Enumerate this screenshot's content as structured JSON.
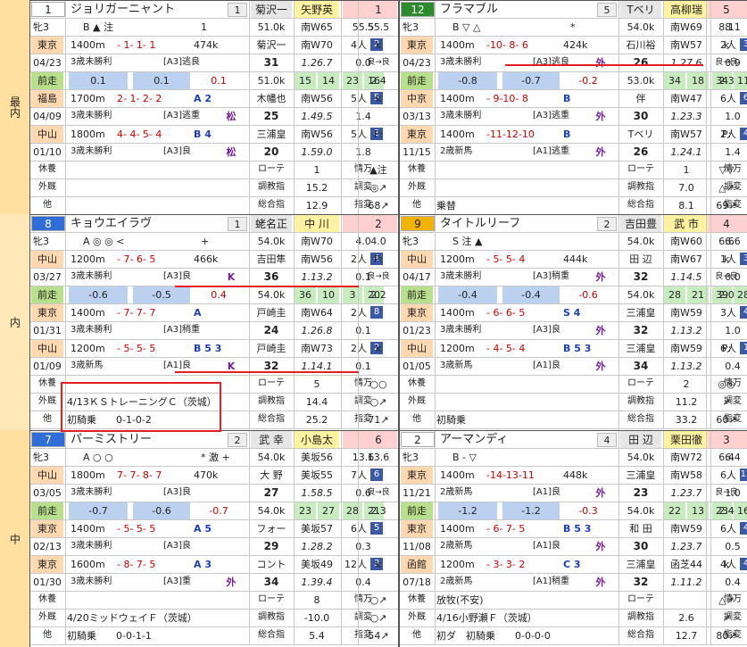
{
  "waku": [
    {
      "label": "最内"
    },
    {
      "label": "内"
    },
    {
      "label": "中"
    }
  ],
  "horses": [
    {
      "id": "h1",
      "num": "1",
      "name": "ジョリガーニャント",
      "gate": "1",
      "jockey_prev": "菊沢一",
      "jockey": "矢野英",
      "odds_a": "1",
      "odds_b": "1",
      "sexage": "牝3",
      "marks": "B ▲ 注",
      "marks2": "1",
      "weight": "51.0k",
      "trainer": "南W65",
      "wt1": "55.5",
      "wt2": "55.5",
      "r1": {
        "tr": "東京",
        "d": "04/23",
        "dist": "1400m",
        "pos": "- 1- 1- 1",
        "wt": "474k",
        "cls": "3歳未勝利",
        "grade": "[A3]逃良",
        "j": "菊沢一",
        "tw": "南W70",
        "pl": "4人",
        "plb": "2",
        "k": "k",
        "n": "31",
        "time": "1.26.7",
        "diff": "0.0",
        "ex": "0.0",
        "fg": "良→良"
      },
      "zen": {
        "a": "0.1",
        "b": "0.1",
        "c": "0.1",
        "t1": "51.0k",
        "t2": "15",
        "t3": "14",
        "t4": "23",
        "t5": "16",
        "t6": "2.4"
      },
      "r2": {
        "tr": "福島",
        "d": "04/09",
        "dist": "1700m",
        "pos": "2- 1- 2- 2",
        "ab": "A 2",
        "cls": "3歳未勝利",
        "grade": "[A3]逃重",
        "mk": "松",
        "j": "木幡也",
        "tw": "南W56",
        "pl": "5人",
        "plb": "5",
        "k": "k",
        "n": "25",
        "time": "1.49.5",
        "diff": "1.4",
        "ex": "0.0"
      },
      "r3": {
        "tr": "中山",
        "d": "01/10",
        "dist": "1800m",
        "pos": "4- 4- 5- 4",
        "ab": "B 4",
        "cls": "3歳未勝利",
        "grade": "[A3]良",
        "mk": "松",
        "j": "三浦皇",
        "tw": "南W56",
        "pl": "5人",
        "plb": "8",
        "k": "P:",
        "n": "20",
        "time": "1.59.0",
        "diff": "1.8",
        "ex": ""
      },
      "foot": {
        "kyu": "休養",
        "ga": "外厩",
        "ta": "他",
        "txt1": "",
        "txt2": "",
        "lot": "ローテ",
        "lotv": "1",
        "jo": "情万",
        "jov": "5",
        "sym": "▲注",
        "cho": "調教指",
        "chov": "15.2",
        "chos": "調変",
        "chosv": "1",
        "symb": "◎↗",
        "sogo": "総合指",
        "sogov": "12.9",
        "sogos": "指変",
        "sogosv": "8",
        "symc": "68↗"
      }
    },
    {
      "id": "h12",
      "num": "12",
      "name": "フラマブル",
      "gate": "5",
      "jockey_prev": "Tベリ",
      "jockey": "高柳瑞",
      "odds_a": "5",
      "odds_b": "5",
      "sexage": "牝3",
      "marks": "B ▽ △",
      "marks2": "*",
      "weight": "54.0k",
      "trainer": "南W69",
      "wt1": "8.1",
      "wt2": "8.1",
      "r1": {
        "tr": "東京",
        "d": "04/23",
        "dist": "1400m",
        "pos": "-10- 8- 6",
        "wt": "424k",
        "cls": "3歳未勝利",
        "grade": "[A3]逃良",
        "mk": "外",
        "j": "石川裕",
        "tw": "南W57",
        "pl": "2人",
        "plb": "3",
        "k": "k",
        "n": "26",
        "time": "1.27.6",
        "diff": "0.9",
        "ex": "1.1",
        "fg": "良→良"
      },
      "zen": {
        "a": "-0.8",
        "b": "-0.7",
        "c": "-0.2",
        "t1": "53.0k",
        "t2": "34",
        "t3": "18",
        "t4": "34",
        "t5": "11",
        "t6": "2.3"
      },
      "r2": {
        "tr": "中京",
        "d": "03/13",
        "dist": "1400m",
        "pos": "- 9-10- 8",
        "ab": "B",
        "cls": "3歳未勝利",
        "grade": "[A3]逃重",
        "mk": "外",
        "j": "伴",
        "tw": "南W47",
        "pl": "6人",
        "plb": "6",
        "k": "",
        "n": "30",
        "time": "1.23.3",
        "diff": "1.0",
        "ex": ""
      },
      "r3": {
        "tr": "東京",
        "d": "11/15",
        "dist": "1400m",
        "pos": "-11-12-10",
        "ab": "B",
        "cls": "2歳新馬",
        "grade": "[A1]逃重",
        "mk": "外",
        "j": "Tベリ",
        "tw": "南W57",
        "pl": "2人",
        "plb": "4",
        "k": "P:",
        "n": "26",
        "time": "1.24.1",
        "diff": "1.4",
        "ex": ""
      },
      "foot": {
        "kyu": "休養",
        "ga": "外厩",
        "ta": "他",
        "txt1": "",
        "txt2": "",
        "txt3": "乗替",
        "lot": "ローテ",
        "lotv": "1",
        "jo": "情万",
        "jov": "10",
        "sym": "▽▽",
        "cho": "調教指",
        "chov": "7.0",
        "chos": "調変",
        "chosv": "2",
        "symb": "△↗",
        "sogo": "総合指",
        "sogov": "8.1",
        "sogos": "指変",
        "sogosv": "4",
        "symc": "69↗"
      }
    },
    {
      "id": "h8",
      "num": "8",
      "name": "キョウエイラヴ",
      "gate": "1",
      "jockey_prev": "蛯名正",
      "jockey": "中 川",
      "odds_a": "2",
      "odds_b": "2",
      "sexage": "牝3",
      "marks": "A ◎ ◎ <",
      "marks2": "+",
      "weight": "54.0k",
      "trainer": "南W70",
      "wt1": "4.0",
      "wt2": "4.0",
      "r1": {
        "tr": "中山",
        "d": "03/27",
        "dist": "1200m",
        "pos": "- 7- 6- 5",
        "wt": "466k",
        "cls": "3歳未勝利",
        "grade": "[A3]良",
        "mk": "K",
        "j": "吉田隼",
        "tw": "南W56",
        "pl": "2人",
        "plb": "4",
        "k": "P:",
        "n": "36",
        "time": "1.13.2",
        "diff": "0.1",
        "ex": "0.0",
        "fg": "良→良"
      },
      "zen": {
        "a": "-0.6",
        "b": "-0.5",
        "c": "0.4",
        "t1": "54.0k",
        "t2": "36",
        "t3": "10",
        "t4": "3",
        "t5": "20",
        "t6": "2.2"
      },
      "r2": {
        "tr": "東京",
        "d": "01/31",
        "dist": "1400m",
        "pos": "- 7- 7- 7",
        "ab": "A",
        "cls": "3歳未勝利",
        "grade": "[A3]稍重",
        "mk": "",
        "j": "戸崎圭",
        "tw": "南W64",
        "pl": "2人",
        "plb": "8",
        "k": "",
        "n": "24",
        "time": "1.26.8",
        "diff": "0.1",
        "ex": ""
      },
      "r3": {
        "tr": "中山",
        "d": "01/09",
        "dist": "1200m",
        "pos": "- 5- 5- 5",
        "ab": "B 5 3",
        "cls": "3歳新馬",
        "grade": "[A1]良",
        "mk": "K",
        "j": "戸崎圭",
        "tw": "南W73",
        "pl": "2人",
        "plb": "2",
        "k": "k",
        "n": "32",
        "time": "1.14.1",
        "diff": "0.1",
        "ex": ""
      },
      "foot": {
        "kyu": "休養",
        "ga": "外厩",
        "ta": "他",
        "txt1": "4/13ＫＳトレーニングＣ（茨城）",
        "txt2": "初騎乗　　0-1-0-2",
        "lot": "ローテ",
        "lotv": "5",
        "jo": "情万",
        "jov": "5",
        "sym": "○○",
        "cho": "調教指",
        "chov": "14.4",
        "chos": "調変",
        "chosv": "1",
        "symb": "○↗",
        "sogo": "総合指",
        "sogov": "25.2",
        "sogos": "指変",
        "sogosv": "2",
        "symc": "71↗"
      }
    },
    {
      "id": "h9",
      "num": "9",
      "name": "タイトルリーフ",
      "gate": "2",
      "jockey_prev": "吉田豊",
      "jockey": "武 市",
      "odds_a": "4",
      "odds_b": "4",
      "sexage": "牝3",
      "marks": "S 注 ▲",
      "marks2": "",
      "weight": "54.0k",
      "trainer": "南W60",
      "wt1": "6.6",
      "wt2": "6.6",
      "r1": {
        "tr": "中山",
        "d": "04/17",
        "dist": "1200m",
        "pos": "- 5- 5- 4",
        "wt": "444k",
        "cls": "3歳未勝利",
        "grade": "[A3]稍重",
        "mk": "外",
        "j": "田 辺",
        "tw": "南W67",
        "pl": "1人",
        "plb": "3",
        "k": "k",
        "n": "32",
        "time": "1.14.5",
        "diff": "0.0",
        "ex": "0.0",
        "fg": "良→良"
      },
      "zen": {
        "a": "-0.4",
        "b": "-0.4",
        "c": "-0.6",
        "t1": "54.0k",
        "t2": "28",
        "t3": "21",
        "t4": "39",
        "t5": "28",
        "t6": "2.0"
      },
      "r2": {
        "tr": "東京",
        "d": "01/23",
        "dist": "1400m",
        "pos": "- 6- 6- 5",
        "ab": "S 4",
        "cls": "3歳未勝利",
        "grade": "[A3]良",
        "mk": "外",
        "j": "三浦皇",
        "tw": "南W59",
        "pl": "3人",
        "plb": "4",
        "k": "",
        "n": "32",
        "time": "1.13.2",
        "diff": "1.0",
        "ex": ""
      },
      "r3": {
        "tr": "中山",
        "d": "01/05",
        "dist": "1200m",
        "pos": "- 4- 5- 4",
        "ab": "B 5 3",
        "cls": "3歳新馬",
        "grade": "[A1]良",
        "mk": "外",
        "j": "三浦皇",
        "tw": "南W59",
        "pl": "6人",
        "plb": "1",
        "k": "P:",
        "n": "34",
        "time": "1.13.2",
        "diff": "0.4",
        "ex": ""
      },
      "foot": {
        "kyu": "休養",
        "ga": "外厩",
        "ta": "他",
        "txt1": "",
        "txt2": "初騎乗",
        "lot": "ローテ",
        "lotv": "2",
        "jo": "情万",
        "jov": "5",
        "sym": "◎◎",
        "cho": "調教指",
        "chov": "11.2",
        "chos": "調変",
        "chosv": "3",
        "symb": "↗",
        "sogo": "総合指",
        "sogov": "33.2",
        "sogos": "指変",
        "sogosv": "7",
        "symc": "60↗"
      }
    },
    {
      "id": "h7",
      "num": "7",
      "name": "パーミストリー",
      "gate": "2",
      "jockey_prev": "武 幸",
      "jockey": "小島太",
      "odds_a": "6",
      "odds_b": "6",
      "sexage": "牝3",
      "marks": "A ○ ○",
      "marks2": "* 激 +",
      "weight": "54.0k",
      "trainer": "美坂56",
      "wt1": "13.6",
      "wt2": "13.6",
      "r1": {
        "tr": "中山",
        "d": "03/05",
        "dist": "1800m",
        "pos": "7- 7- 8- 7",
        "wt": "470k",
        "cls": "3歳未勝利",
        "grade": "[A3]良",
        "mk": "",
        "j": "大 野",
        "tw": "美坂55",
        "pl": "7人",
        "plb": "6",
        "k": "",
        "n": "27",
        "time": "1.58.5",
        "diff": "0.6",
        "ex": "0.0",
        "fg": "良→良"
      },
      "zen": {
        "a": "-0.7",
        "b": "-0.6",
        "c": "-0.7",
        "t1": "54.0k",
        "t2": "23",
        "t3": "27",
        "t4": "28",
        "t5": "21",
        "t6": "2.3"
      },
      "r2": {
        "tr": "東京",
        "d": "02/13",
        "dist": "1400m",
        "pos": "- 5- 5- 5",
        "ab": "A 5",
        "cls": "3歳未勝利",
        "grade": "[A3]良",
        "mk": "",
        "j": "フォー",
        "tw": "美坂57",
        "pl": "6人",
        "plb": "5",
        "k": "",
        "n": "29",
        "time": "1.28.2",
        "diff": "0.3",
        "ex": ""
      },
      "r3": {
        "tr": "東京",
        "d": "01/30",
        "dist": "1600m",
        "pos": "- 8- 7- 5",
        "ab": "A 3",
        "cls": "3歳未勝利",
        "grade": "[A3]重",
        "mk": "外",
        "j": "コント",
        "tw": "美坂49",
        "pl": "12人",
        "plb": "3",
        "k": "k",
        "n": "34",
        "time": "1.39.4",
        "diff": "0.4",
        "ex": ""
      },
      "foot": {
        "kyu": "休養",
        "ga": "外厩",
        "ta": "他",
        "txt1": "4/20ミッドウェイＦ（茨城）",
        "txt2": "初騎乗　　0-0-1-1",
        "lot": "ローテ",
        "lotv": "8",
        "jo": "情万",
        "jov": "6",
        "sym": "○↗",
        "cho": "調教指",
        "chov": "-10.0",
        "chos": "調変",
        "chosv": "2",
        "symb": "○↗",
        "sogo": "総合指",
        "sogov": "5.4",
        "sogos": "指変",
        "sogosv": "3",
        "symc": "54↗"
      }
    },
    {
      "id": "h2",
      "num": "2",
      "name": "アーマンディ",
      "gate": "4",
      "jockey_prev": "田 辺",
      "jockey": "栗田徹",
      "odds_a": "3",
      "odds_b": "3",
      "sexage": "牝3",
      "marks": "B - ▽",
      "marks2": "",
      "weight": "54.0k",
      "trainer": "南W72",
      "wt1": "6.4",
      "wt2": "6.4",
      "r1": {
        "tr": "東京",
        "d": "11/21",
        "dist": "1400m",
        "pos": "-14-13-11",
        "wt": "448k",
        "cls": "2歳新馬",
        "grade": "[A1]良",
        "mk": "外",
        "j": "三浦皇",
        "tw": "南W58",
        "pl": "6人",
        "plb": "12",
        "k": "",
        "n": "23",
        "time": "1.23.7",
        "diff": "1.0",
        "ex": "0.0",
        "fg": "良→良"
      },
      "zen": {
        "a": "-1.2",
        "b": "-1.2",
        "c": "-0.3",
        "t1": "54.0k",
        "t2": "22",
        "t3": "13",
        "t4": "23",
        "t5": "16",
        "t6": "2.4"
      },
      "r2": {
        "tr": "東京",
        "d": "11/08",
        "dist": "1400m",
        "pos": "- 6- 7- 5",
        "ab": "B 5 3",
        "cls": "2歳新馬",
        "grade": "[A1]良",
        "mk": "外",
        "j": "和 田",
        "tw": "南W59",
        "pl": "6人",
        "plb": "4",
        "k": "",
        "n": "30",
        "time": "1.23.7",
        "diff": "0.5",
        "ex": ""
      },
      "r3": {
        "tr": "函館",
        "d": "07/18",
        "dist": "1200m",
        "pos": "- 3- 3- 2",
        "ab": "C 3",
        "cls": "2歳新馬",
        "grade": "[A1]稍重",
        "mk": "外",
        "j": "三浦皇",
        "tw": "函芝44",
        "pl": "4人",
        "plb": "4",
        "k": "k",
        "n": "32",
        "time": "1.11.2",
        "diff": "0.4",
        "ex": ""
      },
      "foot": {
        "kyu": "休養",
        "ga": "外厩",
        "ta": "他",
        "txt1": "放牧(不安)",
        "txt2": "4/16小野瀬Ｆ（茨城）",
        "txt3": "初ダ　初騎乗　　0-0-0-0",
        "lot": "ローテ",
        "lotv": "",
        "jo": "情万",
        "jov": "6",
        "sym": "△↗",
        "cho": "調教指",
        "chov": "2.6",
        "chos": "調変",
        "chosv": "3",
        "symb": "↗",
        "sogo": "総合指",
        "sogov": "12.7",
        "sogos": "指変",
        "sogosv": "3",
        "symc": "80↗"
      }
    }
  ]
}
